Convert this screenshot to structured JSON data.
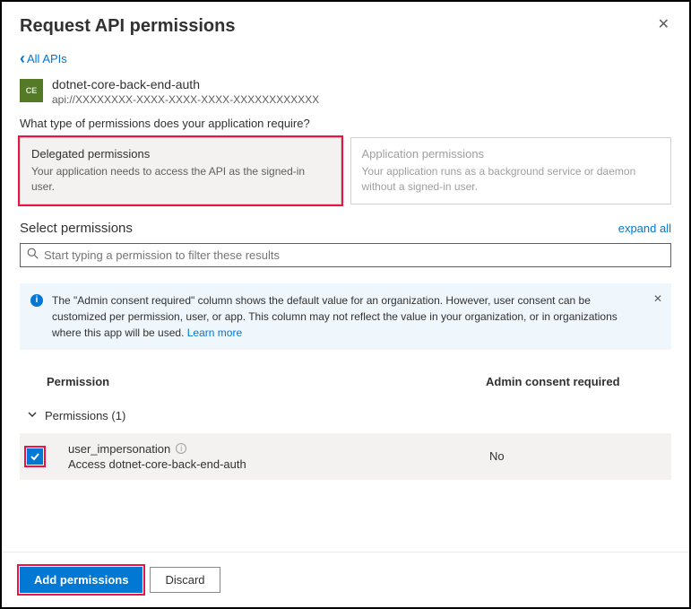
{
  "header": {
    "title": "Request API permissions"
  },
  "back": {
    "label": "All APIs"
  },
  "api": {
    "badge": "CE",
    "name": "dotnet-core-back-end-auth",
    "uri": "api://XXXXXXXX-XXXX-XXXX-XXXX-XXXXXXXXXXXX"
  },
  "question": "What type of permissions does your application require?",
  "permTypes": {
    "delegated": {
      "title": "Delegated permissions",
      "desc": "Your application needs to access the API as the signed-in user."
    },
    "application": {
      "title": "Application permissions",
      "desc": "Your application runs as a background service or daemon without a signed-in user."
    }
  },
  "select": {
    "title": "Select permissions",
    "expand": "expand all",
    "searchPlaceholder": "Start typing a permission to filter these results"
  },
  "info": {
    "text": "The \"Admin consent required\" column shows the default value for an organization. However, user consent can be customized per permission, user, or app. This column may not reflect the value in your organization, or in organizations where this app will be used. ",
    "learnMore": "Learn more"
  },
  "columns": {
    "permission": "Permission",
    "admin": "Admin consent required"
  },
  "group": {
    "label": "Permissions (1)"
  },
  "permission": {
    "name": "user_impersonation",
    "desc": "Access dotnet-core-back-end-auth",
    "admin": "No"
  },
  "buttons": {
    "add": "Add permissions",
    "discard": "Discard"
  }
}
